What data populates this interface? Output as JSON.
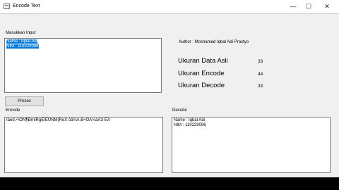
{
  "window": {
    "title": "Encode Text",
    "controls": {
      "minimize": "—",
      "maximize": "☐",
      "close": "✕"
    }
  },
  "input": {
    "label": "Masukkan Input",
    "lines": [
      "Name : Iqbal Adi",
      "NIM : 119229096"
    ]
  },
  "author": "Author : Mochamad Iqbal Adi Prastyo",
  "stats": {
    "original_label": "Ukuran Data Asli",
    "original_value": "33",
    "encode_label": "Ukuran Encode",
    "encode_value": "44",
    "decode_label": "Ukuran Decode",
    "decode_value": "33"
  },
  "process_button": "Proses",
  "encode": {
    "label": "Encode",
    "text": "Ïäed,÷\\ÓÑ¶ÐrnlRgÉ/ÊÜNM(ReX ôä¾Ä,B÷ÔÃ¾áÀ3·ÊÀ"
  },
  "decode": {
    "label": "Decode",
    "lines": [
      "Name : Iqbal Adi",
      "NIM : 119229096"
    ]
  }
}
